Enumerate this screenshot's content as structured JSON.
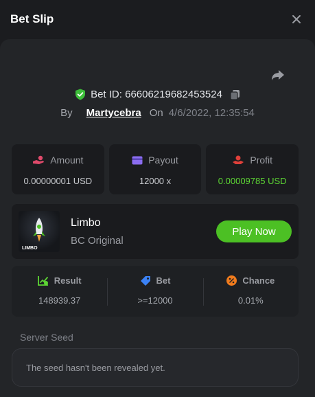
{
  "header": {
    "title": "Bet Slip"
  },
  "bet": {
    "id_text": "Bet ID: 66606219682453524",
    "by_label": "By",
    "user": "Martycebra",
    "on_label": "On",
    "date": "4/6/2022, 12:35:54"
  },
  "stats": [
    {
      "label": "Amount",
      "value": "0.00000001 USD",
      "icon": "hand-coin-icon",
      "color": "#e04a6b"
    },
    {
      "label": "Payout",
      "value": "12000 x",
      "icon": "card-icon",
      "color": "#8a6cf0"
    },
    {
      "label": "Profit",
      "value": "0.00009785 USD",
      "icon": "hand-money-icon",
      "color": "#e0403a"
    }
  ],
  "game": {
    "name": "Limbo",
    "subtitle": "BC Original",
    "thumb_label": "LIMBO",
    "play_label": "Play Now"
  },
  "results": [
    {
      "label": "Result",
      "value": "148939.37",
      "icon": "chart-check-icon",
      "color": "#5dd634"
    },
    {
      "label": "Bet",
      "value": ">=12000",
      "icon": "tag-icon",
      "color": "#3b82f6"
    },
    {
      "label": "Chance",
      "value": "0.01%",
      "icon": "percent-icon",
      "color": "#f07b1d"
    }
  ],
  "seed": {
    "label": "Server Seed",
    "text": "The seed hasn't been revealed yet."
  },
  "colors": {
    "accent_green": "#4cc024",
    "profit_green": "#5dd634",
    "background": "#1b1c1f",
    "panel": "#232528"
  }
}
